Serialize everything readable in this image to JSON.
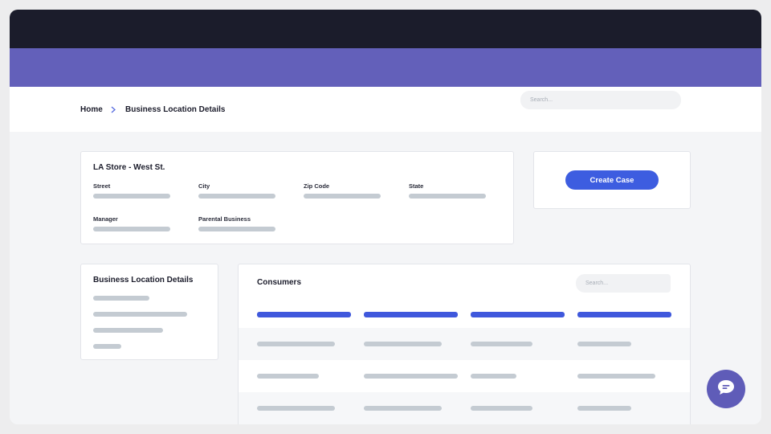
{
  "breadcrumb": {
    "home": "Home",
    "separator": "›",
    "current": "Business Location Details"
  },
  "header_search": {
    "placeholder": "Search..."
  },
  "location_card": {
    "title": "LA Store - West St.",
    "fields": {
      "street": "Street",
      "city": "City",
      "zip": "Zip Code",
      "state": "State",
      "manager": "Manager",
      "parental_business": "Parental Business"
    }
  },
  "actions": {
    "create_case": "Create Case"
  },
  "details_card": {
    "title": "Business Location Details"
  },
  "consumers_card": {
    "title": "Consumers",
    "search_placeholder": "Search..."
  },
  "colors": {
    "topbar": "#1b1c2b",
    "brand": "#6360ba",
    "accent": "#3d5de0",
    "placeholder_bar": "#c4cbd2"
  },
  "icons": {
    "breadcrumb_separator": "chevron-right-icon",
    "chat": "chat-bubble-icon"
  }
}
